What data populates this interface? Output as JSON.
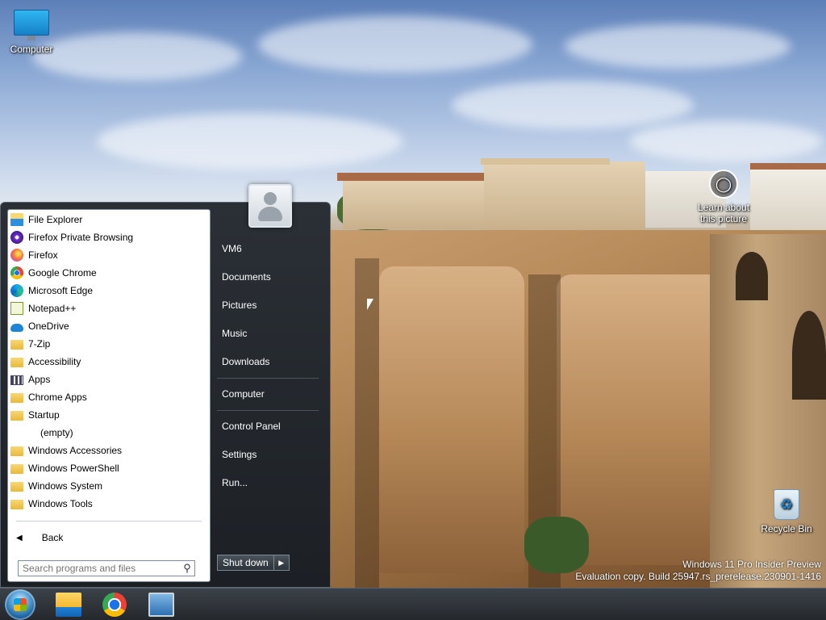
{
  "desktop": {
    "icons": {
      "computer": "Computer",
      "recycle_bin": "Recycle Bin",
      "learn_line1": "Learn about",
      "learn_line2": "this picture"
    },
    "watermark": {
      "line1": "Windows 11 Pro Insider Preview",
      "line2": "Evaluation copy. Build 25947.rs_prerelease.230901-1416"
    }
  },
  "start_menu": {
    "programs": [
      {
        "label": "File Explorer",
        "icon": "file-explorer-icon"
      },
      {
        "label": "Firefox Private Browsing",
        "icon": "firefox-private-icon"
      },
      {
        "label": "Firefox",
        "icon": "firefox-icon"
      },
      {
        "label": "Google Chrome",
        "icon": "chrome-icon"
      },
      {
        "label": "Microsoft Edge",
        "icon": "edge-icon"
      },
      {
        "label": "Notepad++",
        "icon": "notepadpp-icon"
      },
      {
        "label": "OneDrive",
        "icon": "onedrive-icon"
      },
      {
        "label": "7-Zip",
        "icon": "folder-icon"
      },
      {
        "label": "Accessibility",
        "icon": "folder-icon"
      },
      {
        "label": "Apps",
        "icon": "apps-icon"
      },
      {
        "label": "Chrome Apps",
        "icon": "folder-icon"
      },
      {
        "label": "Startup",
        "icon": "folder-icon"
      },
      {
        "label": "(empty)",
        "icon": ""
      },
      {
        "label": "Windows Accessories",
        "icon": "folder-icon"
      },
      {
        "label": "Windows PowerShell",
        "icon": "folder-icon"
      },
      {
        "label": "Windows System",
        "icon": "folder-icon"
      },
      {
        "label": "Windows Tools",
        "icon": "folder-icon"
      }
    ],
    "back_label": "Back",
    "search_placeholder": "Search programs and files",
    "right_links": {
      "user": "VM6",
      "documents": "Documents",
      "pictures": "Pictures",
      "music": "Music",
      "downloads": "Downloads",
      "computer": "Computer",
      "control_panel": "Control Panel",
      "settings": "Settings",
      "run": "Run..."
    },
    "shutdown_label": "Shut down"
  },
  "taskbar": {
    "pinned": [
      "file-explorer-icon",
      "chrome-icon",
      "remote-desktop-icon"
    ]
  }
}
